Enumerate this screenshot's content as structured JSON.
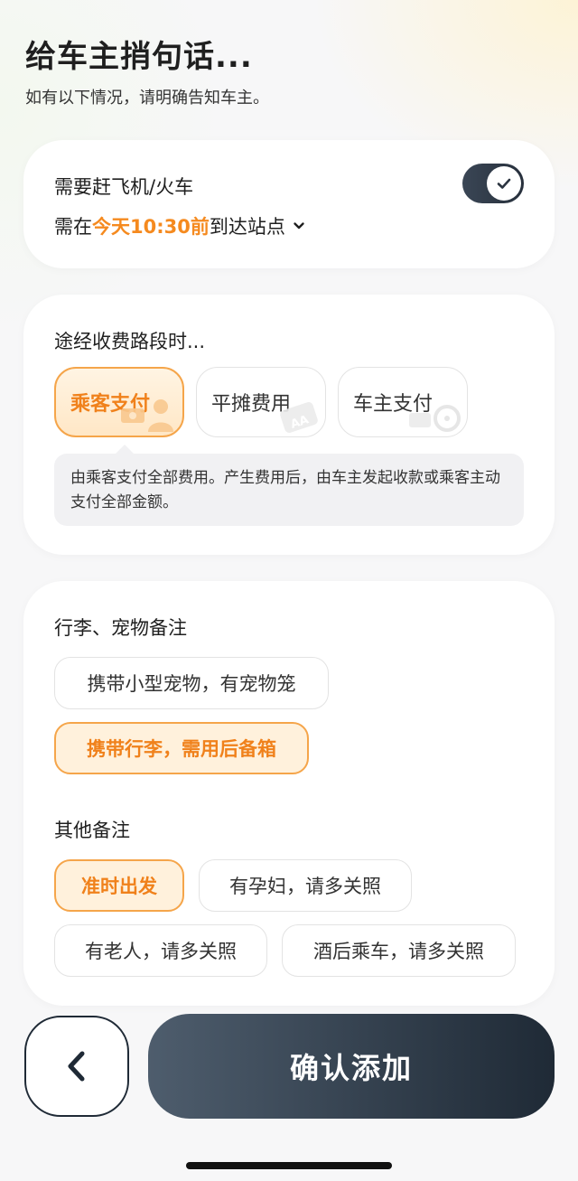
{
  "header": {
    "title": "给车主捎句话...",
    "subtitle": "如有以下情况，请明确告知车主。"
  },
  "flight": {
    "label": "需要赶飞机/火车",
    "toggle_on": true,
    "prefix": "需在",
    "highlight": "今天10:30前",
    "suffix": "到达站点",
    "chevron_icon": "chevron-down-icon"
  },
  "toll": {
    "title": "途经收费路段时...",
    "options": [
      {
        "label": "乘客支付",
        "selected": true,
        "icon": "passenger-pay-icon"
      },
      {
        "label": "平摊费用",
        "selected": false,
        "icon": "aa-split-icon"
      },
      {
        "label": "车主支付",
        "selected": false,
        "icon": "steering-wheel-icon"
      }
    ],
    "description": "由乘客支付全部费用。产生费用后，由车主发起收款或乘客主动支付全部金额。"
  },
  "luggage": {
    "title": "行李、宠物备注",
    "chips": [
      {
        "label": "携带小型宠物，有宠物笼",
        "selected": false
      },
      {
        "label": "携带行李，需用后备箱",
        "selected": true
      }
    ]
  },
  "other": {
    "title": "其他备注",
    "chips": [
      {
        "label": "准时出发",
        "selected": true
      },
      {
        "label": "有孕妇，请多关照",
        "selected": false
      },
      {
        "label": "有老人，请多关照",
        "selected": false
      },
      {
        "label": "酒后乘车，请多关照",
        "selected": false
      }
    ]
  },
  "footer": {
    "back_icon": "chevron-left-icon",
    "confirm_label": "确认添加"
  },
  "colors": {
    "accent": "#f58a1f",
    "dark_button": "#1f2a36"
  }
}
